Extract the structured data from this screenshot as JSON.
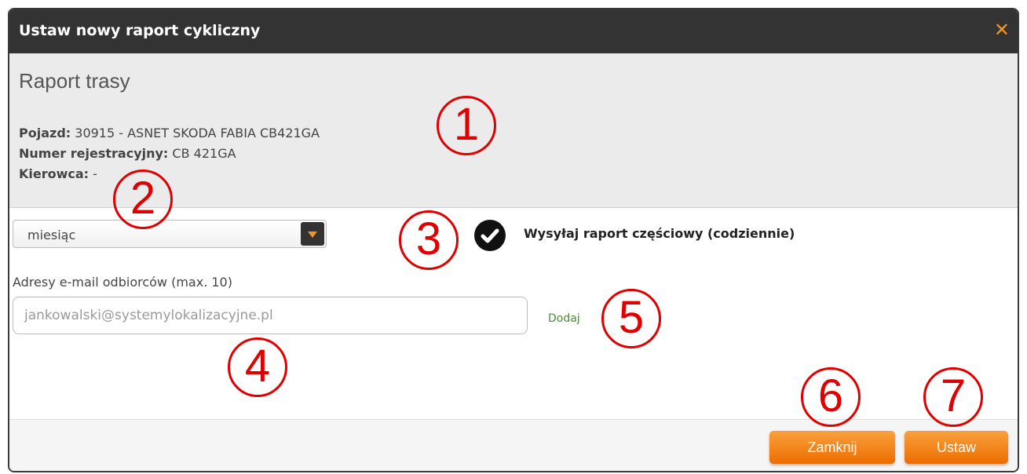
{
  "dialog": {
    "title": "Ustaw nowy raport cykliczny",
    "close_symbol": "✕"
  },
  "info": {
    "report_title": "Raport trasy",
    "vehicle_label": "Pojazd:",
    "vehicle_value": " 30915 - ASNET SKODA FABIA CB421GA",
    "registration_label": "Numer rejestracyjny:",
    "registration_value": " CB 421GA",
    "driver_label": "Kierowca:",
    "driver_value": " -"
  },
  "period_select": {
    "value": "miesiąc"
  },
  "partial_report": {
    "checked": true,
    "label": "Wysyłaj raport częściowy (codziennie)"
  },
  "email": {
    "label": "Adresy e-mail odbiorców (max. 10)",
    "placeholder": "jankowalski@systemylokalizacyjne.pl",
    "add_label": "Dodaj"
  },
  "footer": {
    "close_label": "Zamknij",
    "set_label": "Ustaw"
  },
  "annotations": [
    "1",
    "2",
    "3",
    "4",
    "5",
    "6",
    "7"
  ],
  "colors": {
    "accent": "#f7941d",
    "titlebar": "#333333",
    "marker": "#e00000",
    "link": "#4a8a3a"
  }
}
